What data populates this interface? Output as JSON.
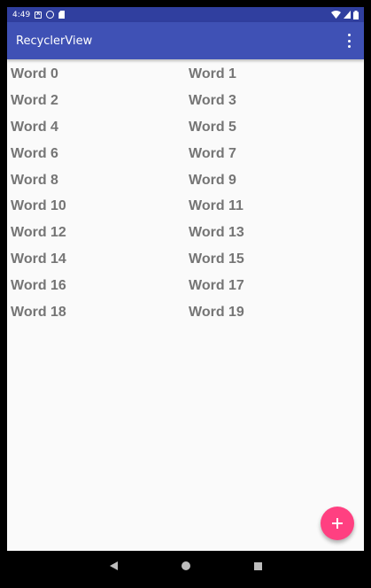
{
  "status_bar": {
    "time": "4:49",
    "notification_icons": [
      "a-box-icon",
      "circle-notification-icon",
      "sd-card-icon"
    ],
    "system_icons": [
      "wifi-icon",
      "signal-icon",
      "battery-icon"
    ]
  },
  "app_bar": {
    "title": "RecyclerView",
    "menu_icon": "more-vert-icon"
  },
  "words": [
    "Word 0",
    "Word 1",
    "Word 2",
    "Word 3",
    "Word 4",
    "Word 5",
    "Word 6",
    "Word 7",
    "Word 8",
    "Word 9",
    "Word 10",
    "Word 11",
    "Word 12",
    "Word 13",
    "Word 14",
    "Word 15",
    "Word 16",
    "Word 17",
    "Word 18",
    "Word 19"
  ],
  "fab": {
    "icon": "add-icon",
    "color": "#ff4081"
  },
  "colors": {
    "primary": "#3f51b5",
    "primary_dark": "#303f9f",
    "accent": "#ff4081",
    "text": "#757575"
  },
  "nav_bar": {
    "icons": [
      "back-icon",
      "home-icon",
      "recents-icon"
    ]
  }
}
